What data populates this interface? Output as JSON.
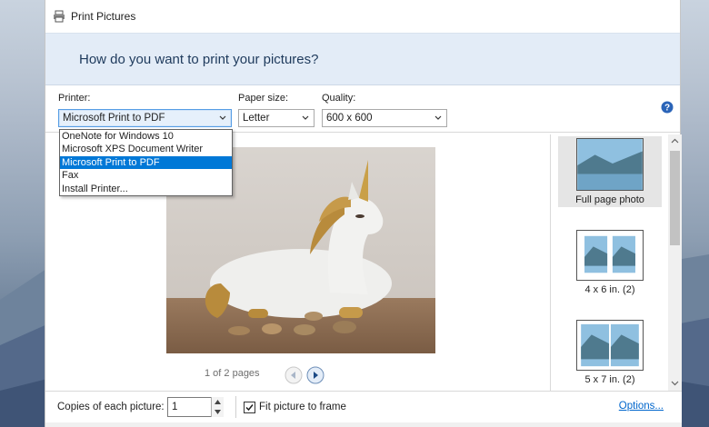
{
  "window": {
    "title": "Print Pictures",
    "question": "How do you want to print your pictures?"
  },
  "controls": {
    "printer_label": "Printer:",
    "printer_value": "Microsoft Print to PDF",
    "paper_label": "Paper size:",
    "paper_value": "Letter",
    "quality_label": "Quality:",
    "quality_value": "600 x 600"
  },
  "printer_dropdown": {
    "options": [
      "OneNote for Windows 10",
      "Microsoft XPS Document Writer",
      "Microsoft Print to PDF",
      "Fax",
      "Install Printer..."
    ],
    "selected": "Microsoft Print to PDF"
  },
  "preview": {
    "pager_text": "1 of 2 pages"
  },
  "layouts": [
    {
      "label": "Full page photo",
      "selected": true
    },
    {
      "label": "4 x 6 in. (2)",
      "selected": false
    },
    {
      "label": "5 x 7 in. (2)",
      "selected": false
    }
  ],
  "footer": {
    "copies_label": "Copies of each picture:",
    "copies_value": "1",
    "fit_label": "Fit picture to frame",
    "fit_checked": true,
    "options_link": "Options..."
  },
  "colors": {
    "header_band": "#e3ecf7",
    "selection_blue": "#0078d7",
    "link_blue": "#0066cc"
  },
  "icons": [
    "printer-icon",
    "help-icon",
    "chevron-down-icon",
    "prev-page-icon",
    "next-page-icon",
    "scroll-up-icon",
    "scroll-down-icon",
    "spin-up-icon",
    "spin-down-icon",
    "checkmark-icon"
  ]
}
